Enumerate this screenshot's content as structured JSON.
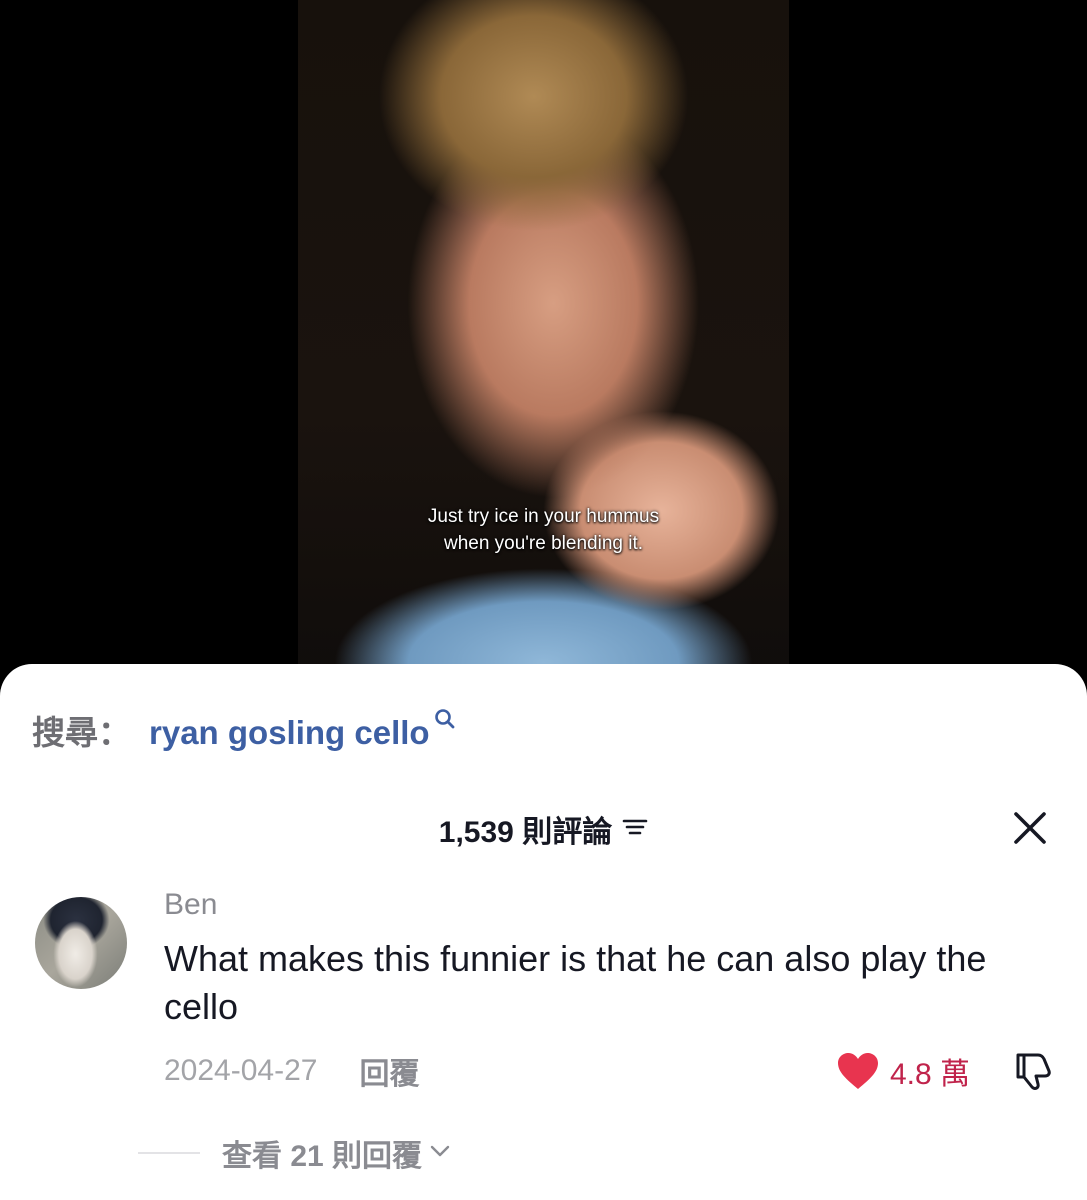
{
  "video": {
    "subtitle_line1": "Just try ice in your hummus",
    "subtitle_line2": "when you're blending it."
  },
  "search": {
    "label": "搜尋：",
    "query": "ryan gosling cello",
    "icon": "search-icon",
    "query_color": "#3d5fa3"
  },
  "comments": {
    "header": "1,539 則評論",
    "sort_icon": "sort-icon",
    "close_icon": "close-icon"
  },
  "comment": {
    "username": "Ben",
    "text": "What makes this funnier is that he can also play the cello",
    "date": "2024-04-27",
    "reply_label": "回覆",
    "likes": "4.8 萬",
    "like_icon": "heart-icon",
    "like_color": "#e8344f",
    "dislike_icon": "dislike-icon",
    "view_replies": "查看 21 則回覆"
  }
}
